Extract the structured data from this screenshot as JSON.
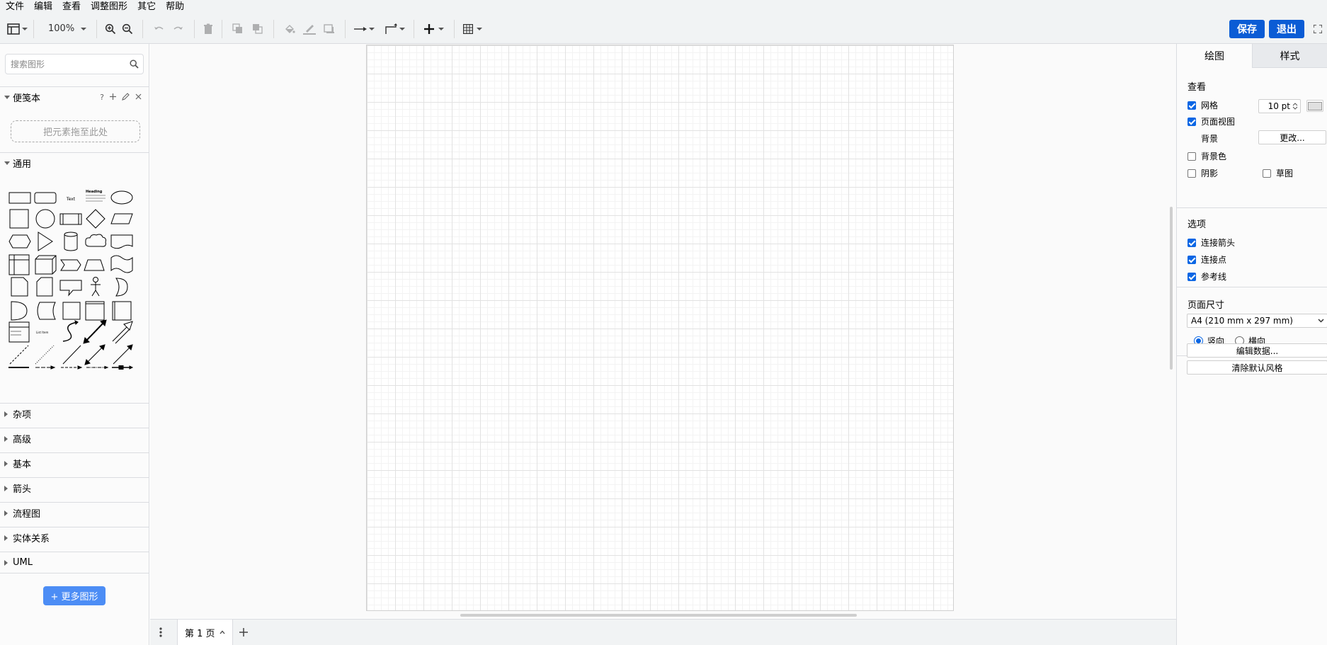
{
  "menubar": {
    "items": [
      "文件",
      "编辑",
      "查看",
      "调整图形",
      "其它",
      "帮助"
    ]
  },
  "toolbar": {
    "zoom": "100%",
    "save_label": "保存",
    "exit_label": "退出",
    "icons": [
      "layout-icon",
      "zoom-in-icon",
      "zoom-out-icon",
      "undo-icon",
      "redo-icon",
      "delete-icon",
      "to-front-icon",
      "to-back-icon",
      "fill-color-icon",
      "line-color-icon",
      "shadow-icon",
      "connection-icon",
      "waypoints-icon",
      "insert-icon",
      "table-icon",
      "fullscreen-icon"
    ]
  },
  "sidebar": {
    "search_placeholder": "搜索图形",
    "scratchpad": {
      "title": "便笺本",
      "help": "?",
      "drop_hint": "把元素拖至此处"
    },
    "general": {
      "title": "通用",
      "text_shape_label": "Text",
      "heading_shape_label": "Heading",
      "list_item_label": "List Item"
    },
    "collapsed_sections": [
      "杂项",
      "高级",
      "基本",
      "箭头",
      "流程图",
      "实体关系",
      "UML"
    ],
    "more_shapes_label": "+ 更多图形"
  },
  "bottombar": {
    "page_tab": "第 1 页"
  },
  "rpanel": {
    "tabs": [
      "绘图",
      "样式"
    ],
    "view": {
      "title": "查看",
      "grid_label": "网格",
      "grid_checked": true,
      "grid_size": "10 pt",
      "page_view_label": "页面视图",
      "page_view_checked": true,
      "background_label": "背景",
      "change_button": "更改...",
      "bg_color_label": "背景色",
      "shadow_label": "阴影",
      "sketch_label": "草图"
    },
    "options": {
      "title": "选项",
      "connection_arrows": "连接箭头",
      "connection_points": "连接点",
      "guides": "参考线"
    },
    "page_size": {
      "title": "页面尺寸",
      "selected": "A4 (210 mm x 297 mm)",
      "portrait": "竖向",
      "landscape": "横向"
    },
    "edit_data_button": "编辑数据...",
    "clear_style_button": "清除默认风格"
  },
  "colors": {
    "accent": "#0b5cd5",
    "more_shapes_bg": "#4c8df5"
  }
}
